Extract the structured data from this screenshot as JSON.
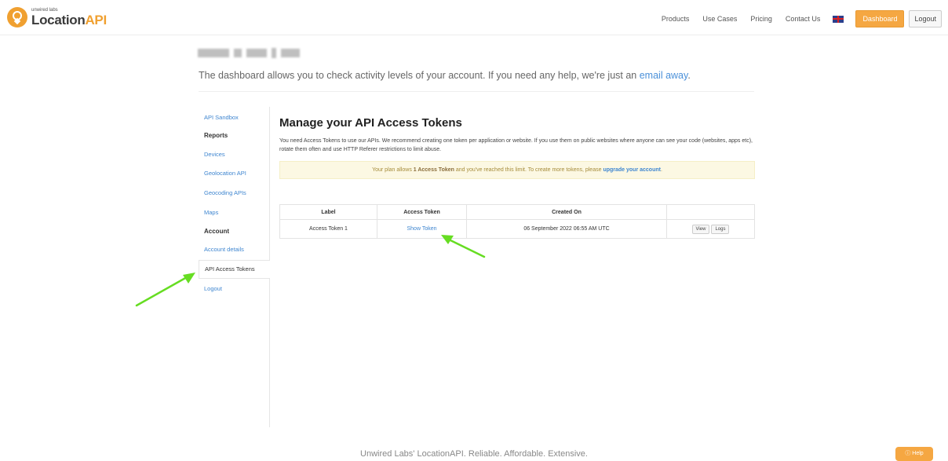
{
  "brand": {
    "small": "unwired labs",
    "name": "Location",
    "name_accent": "API"
  },
  "nav": {
    "links": [
      "Products",
      "Use Cases",
      "Pricing",
      "Contact Us"
    ],
    "dashboard": "Dashboard",
    "logout": "Logout"
  },
  "intro": {
    "text": "The dashboard allows you to check activity levels of your account. If you need any help, we're just an ",
    "link": "email away",
    "end": "."
  },
  "sidebar": {
    "api_sandbox": "API Sandbox",
    "reports_heading": "Reports",
    "devices": "Devices",
    "geolocation_api": "Geolocation API",
    "geocoding_apis": "Geocoding APIs",
    "maps": "Maps",
    "account_heading": "Account",
    "account_details": "Account details",
    "api_access_tokens": "API Access Tokens",
    "logout": "Logout"
  },
  "main": {
    "title": "Manage your API Access Tokens",
    "description": "You need Access Tokens to use our APIs. We recommend creating one token per application or website. If you use them on public websites where anyone can see your code (websites, apps etc), rotate them often and use HTTP Referer restrictions to limit abuse.",
    "alert": {
      "prefix": "Your plan allows ",
      "bold": "1 Access Token",
      "middle": " and you've reached this limit. To create more tokens, please ",
      "link": "upgrade your account",
      "end": "."
    },
    "table": {
      "headers": [
        "Label",
        "Access Token",
        "Created On",
        ""
      ],
      "rows": [
        {
          "label": "Access Token 1",
          "token": "Show Token",
          "created": "06 September 2022 06:55 AM UTC",
          "view": "View",
          "logs": "Logs"
        }
      ]
    }
  },
  "footer": "Unwired Labs' LocationAPI. Reliable. Affordable. Extensive.",
  "help": "Help",
  "colors": {
    "accent": "#f5a742",
    "link": "#3f86d0",
    "arrow": "#66dd22",
    "alert_bg": "#fcf8e3"
  },
  "icons": [
    "location-logo-icon",
    "uk-flag-icon",
    "help-icon",
    "arrow-annotation"
  ]
}
